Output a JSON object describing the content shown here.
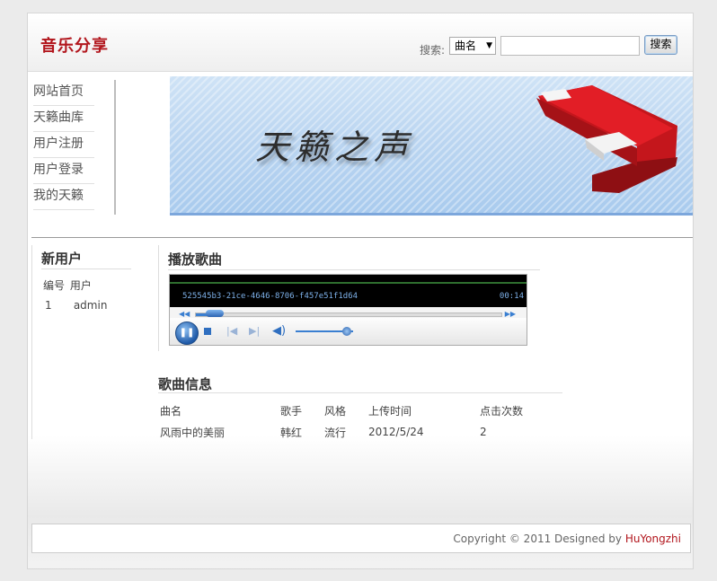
{
  "header": {
    "logo": "音乐分享",
    "search_label": "搜索:",
    "search_select": "曲名",
    "search_value": "",
    "search_button": "搜索"
  },
  "nav": {
    "items": [
      {
        "label": "网站首页"
      },
      {
        "label": "天籁曲库"
      },
      {
        "label": "用户注册"
      },
      {
        "label": "用户登录"
      },
      {
        "label": "我的天籁"
      }
    ]
  },
  "banner": {
    "text": "天籁之声"
  },
  "users": {
    "title": "新用户",
    "col_id": "编号",
    "col_user": "用户",
    "rows": [
      {
        "id": "1",
        "name": "admin"
      }
    ]
  },
  "player": {
    "title": "播放歌曲",
    "track_id": "525545b3-21ce-4646-8706-f457e51f1d64",
    "time": "00:14",
    "progress": 0.07,
    "volume": 0.8
  },
  "song_info": {
    "title": "歌曲信息",
    "headers": [
      "曲名",
      "歌手",
      "风格",
      "上传时间",
      "点击次数"
    ],
    "rows": [
      [
        "风雨中的美丽",
        "韩红",
        "流行",
        "2012/5/24",
        "2"
      ]
    ]
  },
  "footer": {
    "copyright": "Copyright © 2011 Designed by ",
    "author": "HuYongzhi"
  },
  "colors": {
    "brand": "#b2161d",
    "player_accent": "#3a7fd1"
  }
}
